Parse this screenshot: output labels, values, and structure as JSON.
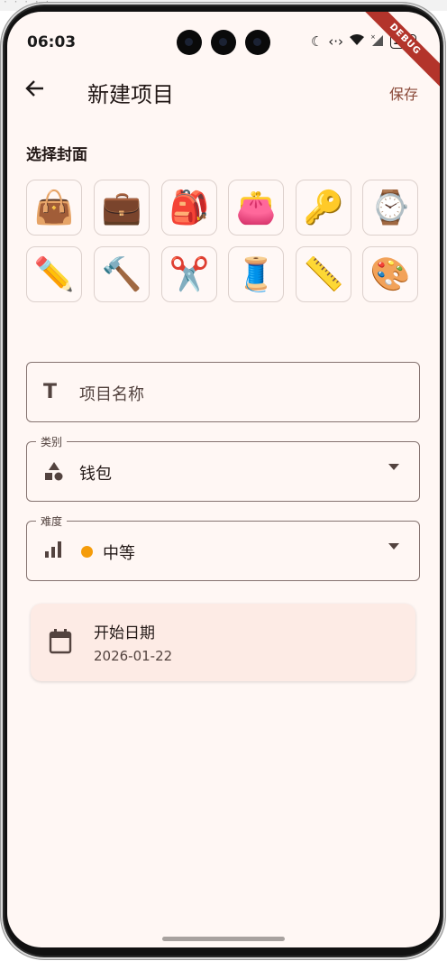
{
  "status_bar": {
    "time": "06:03",
    "battery": "100",
    "debug_banner": "DEBUG"
  },
  "app_bar": {
    "back_icon": "arrow-left-icon",
    "title": "新建项目",
    "save_label": "保存"
  },
  "cover_section": {
    "title": "选择封面",
    "covers": [
      {
        "icon": "👜",
        "name": "handbag"
      },
      {
        "icon": "💼",
        "name": "briefcase"
      },
      {
        "icon": "🎒",
        "name": "backpack"
      },
      {
        "icon": "👛",
        "name": "wallet"
      },
      {
        "icon": "🔑",
        "name": "key"
      },
      {
        "icon": "⌚",
        "name": "watch"
      },
      {
        "icon": "✏️",
        "name": "pencil"
      },
      {
        "icon": "🔨",
        "name": "hammer"
      },
      {
        "icon": "✂️",
        "name": "scissors"
      },
      {
        "icon": "🧵",
        "name": "thread"
      },
      {
        "icon": "📏",
        "name": "ruler"
      },
      {
        "icon": "🎨",
        "name": "palette"
      }
    ]
  },
  "form": {
    "name_placeholder": "项目名称",
    "category": {
      "label": "类别",
      "value": "钱包"
    },
    "difficulty": {
      "label": "难度",
      "value": "中等",
      "dot_color": "#f59c0a"
    },
    "start_date": {
      "label": "开始日期",
      "value": "2026-01-22"
    }
  },
  "colors": {
    "background": "#fff7f4",
    "accent": "#8b4b3a",
    "card": "#fdebe5"
  }
}
